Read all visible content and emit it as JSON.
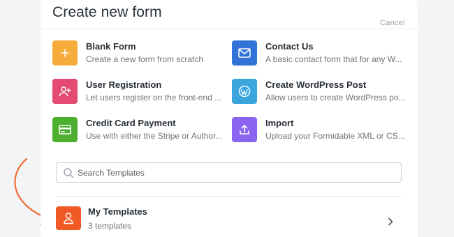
{
  "modal": {
    "title": "Create new form",
    "cancel_label": "Cancel"
  },
  "options": [
    {
      "title": "Blank Form",
      "description": "Create a new form from scratch",
      "icon": "plus-icon",
      "color": "#f5ac3b"
    },
    {
      "title": "Contact Us",
      "description": "A basic contact form that for any W...",
      "icon": "mail-icon",
      "color": "#3173d6"
    },
    {
      "title": "User Registration",
      "description": "Let users register on the front-end ...",
      "icon": "user-add-icon",
      "color": "#e44b72"
    },
    {
      "title": "Create WordPress Post",
      "description": "Allow users to create WordPress po...",
      "icon": "wordpress-icon",
      "color": "#3ba5de"
    },
    {
      "title": "Credit Card Payment",
      "description": "Use with either the Stripe or Author...",
      "icon": "credit-card-icon",
      "color": "#4caf2f"
    },
    {
      "title": "Import",
      "description": "Upload your Formidable XML or CS...",
      "icon": "upload-icon",
      "color": "#8a63f0"
    }
  ],
  "search": {
    "placeholder": "Search Templates"
  },
  "my_templates": {
    "title": "My Templates",
    "count_text": "3 templates",
    "icon": "user-icon",
    "color": "#f15a24"
  },
  "annotation": {
    "arrow_color": "#f06b35"
  }
}
